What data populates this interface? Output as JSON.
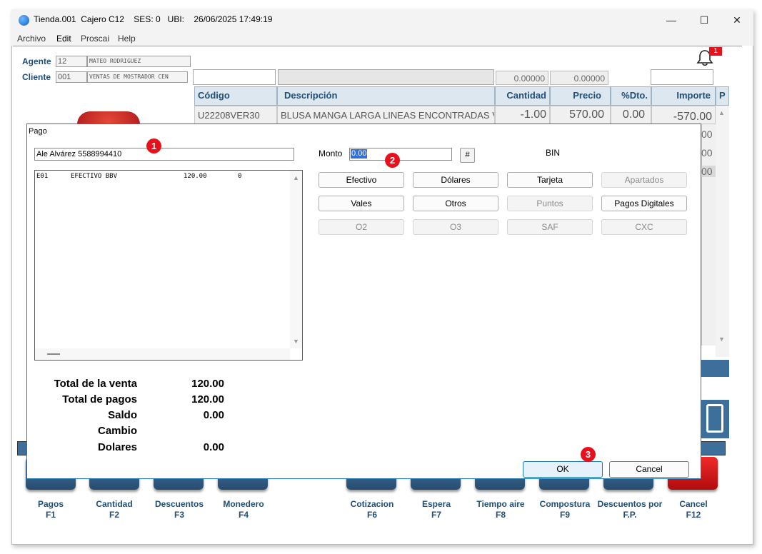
{
  "window": {
    "title": "Tienda.001  Cajero C12    SES: 0   UBI:    26/06/2025 17:49:19",
    "minimize": "—",
    "maximize": "☐",
    "close": "✕"
  },
  "menu": [
    "Archivo",
    "Edit",
    "Proscai",
    "Help"
  ],
  "header": {
    "agent_label": "Agente",
    "agent_code": "12",
    "agent_name": "MATEO RODRIGUEZ",
    "client_label": "Cliente",
    "client_code": "001",
    "client_name": "VENTAS DE MOSTRADOR CEN",
    "total1": "0.00000",
    "total2": "0.00000",
    "notification_count": "1"
  },
  "grid": {
    "columns": [
      "Código",
      "Descripción",
      "Cantidad",
      "Precio",
      "%Dto.",
      "Importe",
      "P"
    ],
    "rows": [
      {
        "codigo": "U22208VER30",
        "descripcion": "BLUSA MANGA LARGA LINEAS ENCONTRADAS VE",
        "cantidad": "-1.00",
        "precio": "570.00",
        "dto": "0.00",
        "importe": "-570.00"
      }
    ],
    "partial_values": [
      "00",
      "00",
      "00"
    ]
  },
  "toolbar": [
    {
      "label": "Pagos",
      "key": "F1"
    },
    {
      "label": "Cantidad",
      "key": "F2"
    },
    {
      "label": "Descuentos",
      "key": "F3"
    },
    {
      "label": "Monedero",
      "key": "F4"
    },
    {
      "label": "Cotizacion",
      "key": "F6"
    },
    {
      "label": "Espera",
      "key": "F7"
    },
    {
      "label": "Tiempo aire",
      "key": "F8"
    },
    {
      "label": "Compostura",
      "key": "F9"
    },
    {
      "label": "Descuentos por",
      "key": "F.P."
    },
    {
      "label": "Cancel",
      "key": "F12"
    }
  ],
  "dialog": {
    "title": "Pago",
    "customer": "Ale Alvárez 5588994410",
    "payment_row": {
      "code": "E01",
      "name": "EFECTIVO BBV",
      "amount": "120.00",
      "extra": "0"
    },
    "monto_label": "Monto",
    "monto_value": "0.00",
    "hash_label": "#",
    "bin_label": "BIN",
    "buttons": [
      {
        "label": "Efectivo",
        "enabled": true
      },
      {
        "label": "Dólares",
        "enabled": true
      },
      {
        "label": "Tarjeta",
        "enabled": true
      },
      {
        "label": "Apartados",
        "enabled": false
      },
      {
        "label": "Vales",
        "enabled": true
      },
      {
        "label": "Otros",
        "enabled": true
      },
      {
        "label": "Puntos",
        "enabled": false
      },
      {
        "label": "Pagos Digitales",
        "enabled": true
      },
      {
        "label": "O2",
        "enabled": false
      },
      {
        "label": "O3",
        "enabled": false
      },
      {
        "label": "SAF",
        "enabled": false
      },
      {
        "label": "CXC",
        "enabled": false
      }
    ],
    "totals": [
      {
        "label": "Total de la venta",
        "value": "120.00"
      },
      {
        "label": "Total de pagos",
        "value": "120.00"
      },
      {
        "label": "Saldo",
        "value": "0.00"
      },
      {
        "label": "Cambio",
        "value": ""
      },
      {
        "label": "Dolares",
        "value": "0.00"
      }
    ],
    "ok_label": "OK",
    "cancel_label": "Cancel"
  },
  "annotations": [
    "1",
    "2",
    "3"
  ]
}
